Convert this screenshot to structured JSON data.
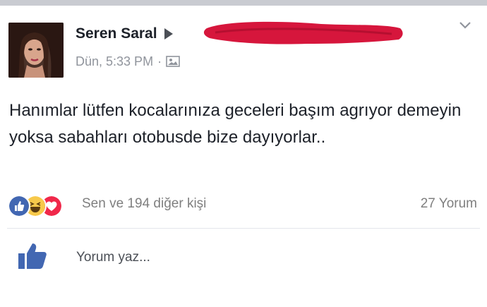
{
  "post": {
    "author": "Seren Saral",
    "timestamp": "Dün, 5:33 PM",
    "meta_separator": "·",
    "privacy_icon": "photo-privacy-icon",
    "text": "Hanımlar lütfen kocalarınıza geceleri başım agrıyor demeyin yoksa sabahları otobusde bize dayıyorlar.."
  },
  "reactions": {
    "icons": [
      "like-icon",
      "haha-icon",
      "love-icon"
    ],
    "summary": "Sen ve 194 diğer kişi",
    "comments": "27 Yorum"
  },
  "comment_box": {
    "placeholder": "Yorum yaz..."
  },
  "colors": {
    "like_blue": "#4267b2",
    "love_red": "#f0284a",
    "haha_yellow": "#f7c94b",
    "redaction": "#d6163c"
  }
}
